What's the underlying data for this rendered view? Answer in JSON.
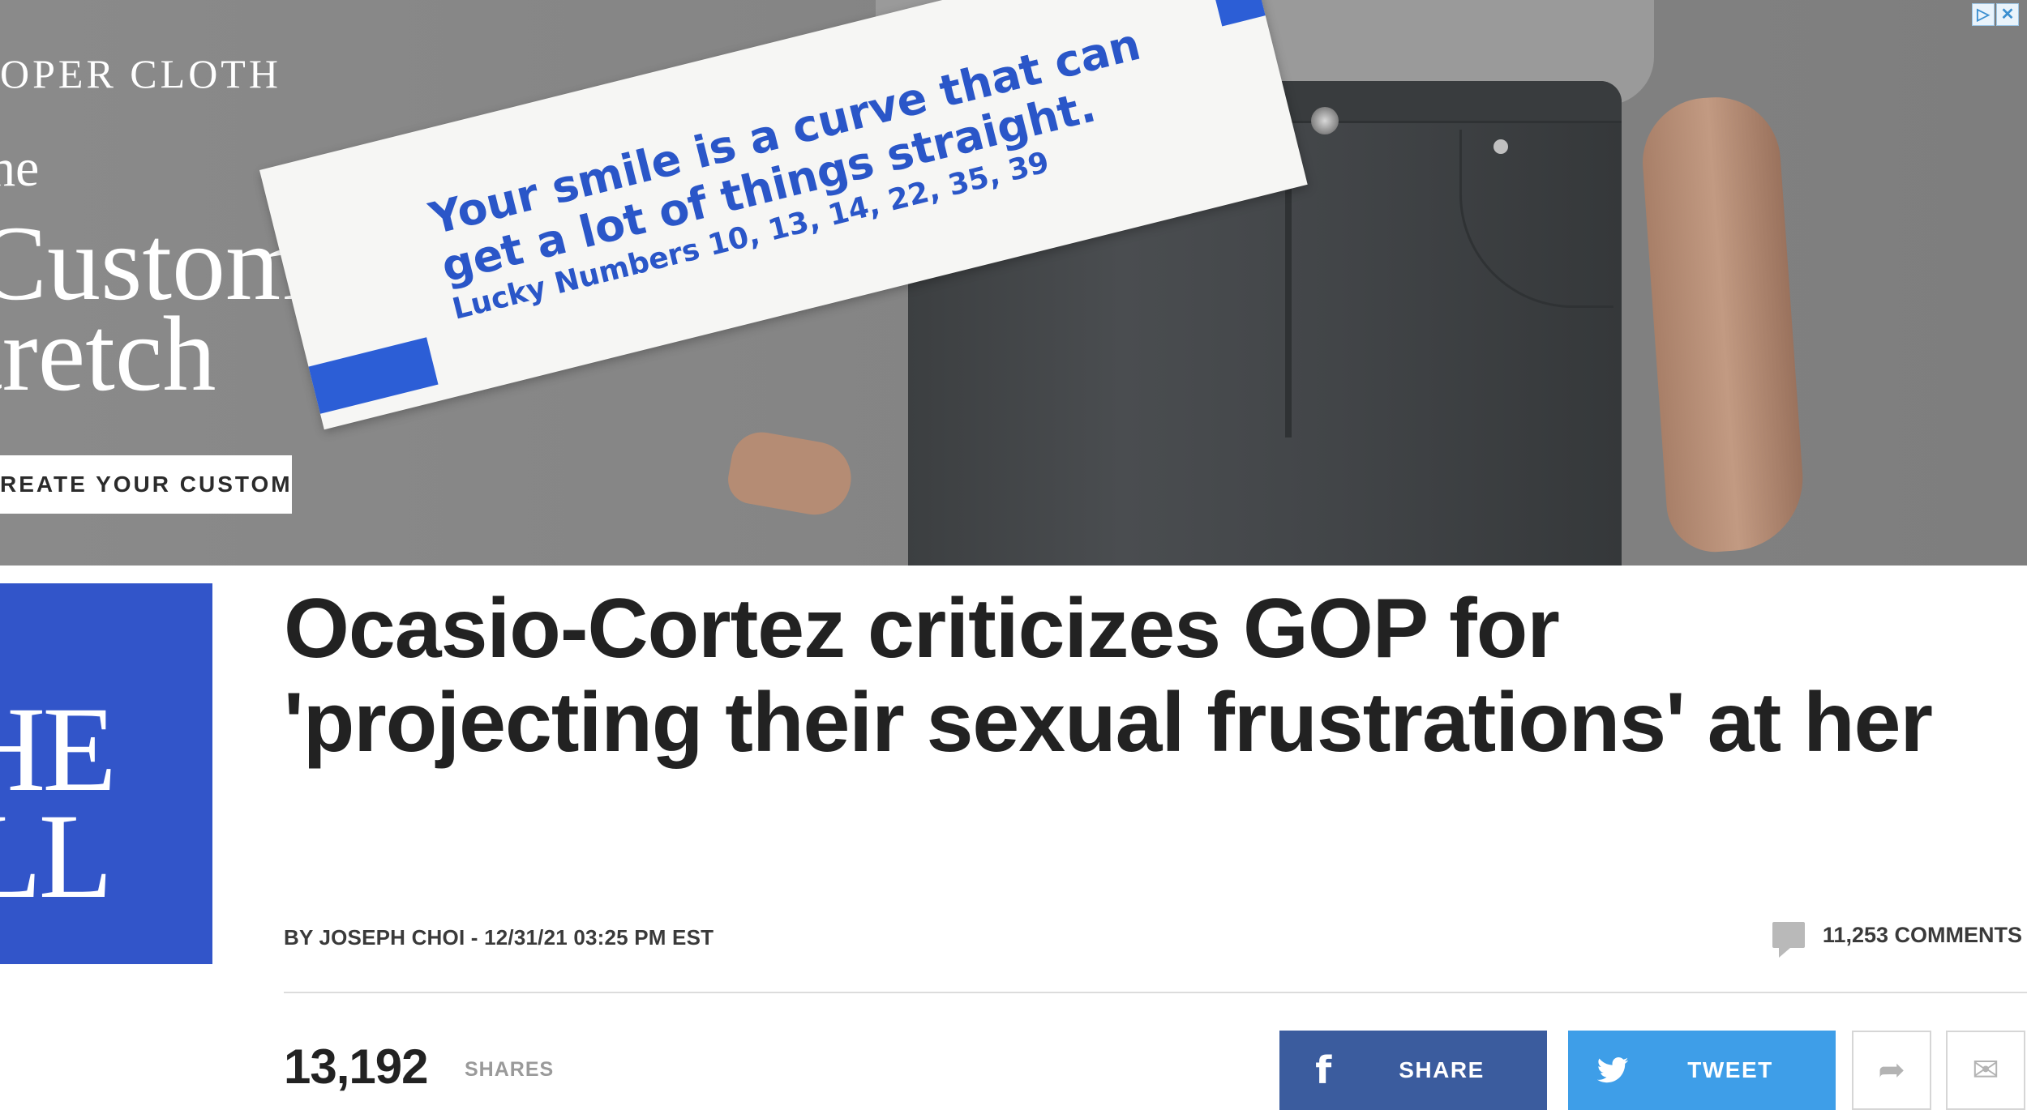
{
  "ad": {
    "brand": "OPER CLOTH",
    "the": "he",
    "headline_line1": "Custom Fit",
    "headline_line2": "tretch",
    "cta": "REATE YOUR CUSTOM",
    "adchoices_icons": [
      "adchoices-icon",
      "close-icon"
    ]
  },
  "fortune": {
    "line1": "Your smile is a curve that can",
    "line2": "get a lot of things straight.",
    "line3": "Lucky Numbers  10, 13, 14, 22, 35, 39"
  },
  "logo": {
    "line1": "HE",
    "line2": "LL"
  },
  "article": {
    "headline": "Ocasio-Cortez criticizes GOP for 'projecting their sexual frustrations' at her",
    "byline": "BY JOSEPH CHOI - 12/31/21 03:25 PM EST",
    "comments": "11,253  COMMENTS",
    "shares_count": "13,192",
    "shares_label": "SHARES"
  },
  "social": {
    "facebook_label": "SHARE",
    "twitter_label": "TWEET",
    "facebook_icon": "f",
    "share_icon": "➦",
    "mail_icon": "✉"
  },
  "colors": {
    "logo_blue": "#3255c9",
    "facebook": "#3b5c9e",
    "twitter": "#3e9ee8",
    "fortune_ink": "#2a56c8"
  }
}
